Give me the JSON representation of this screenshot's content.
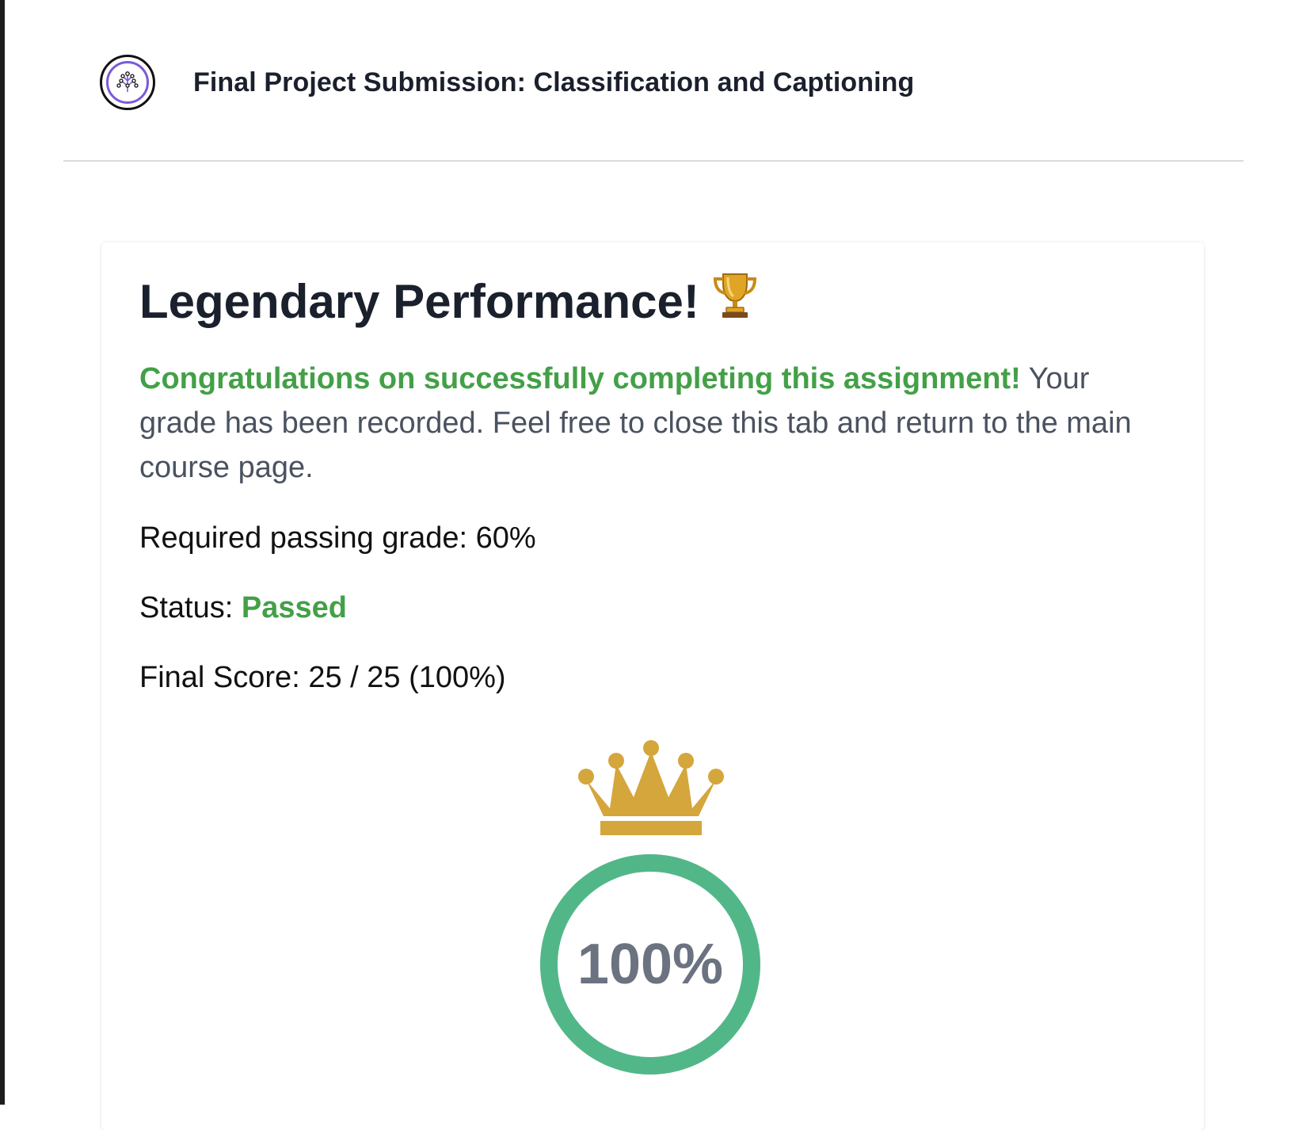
{
  "header": {
    "title": "Final Project Submission: Classification and Captioning",
    "logo_icon": "tree-network-icon"
  },
  "result": {
    "heading": "Legendary Performance!",
    "heading_icon": "trophy-icon",
    "congrats_text": "Congratulations on successfully completing this assignment!",
    "message_text": " Your grade has been recorded. Feel free to close this tab and return to the main course page.",
    "required_label": "Required passing grade: ",
    "required_value": "60%",
    "status_label": "Status: ",
    "status_value": "Passed",
    "score_label": "Final Score: ",
    "score_value": "25 / 25 (100%)",
    "ring_value_text": "100%",
    "ring_fraction": 1.0,
    "badge_icon": "crown-icon"
  },
  "colors": {
    "success_green": "#43a047",
    "ring_green": "#52b788",
    "crown_gold": "#d4a63c",
    "heading_dark": "#1a202c",
    "body_gray": "#4a5260",
    "logo_purple": "#7b5bd6"
  }
}
